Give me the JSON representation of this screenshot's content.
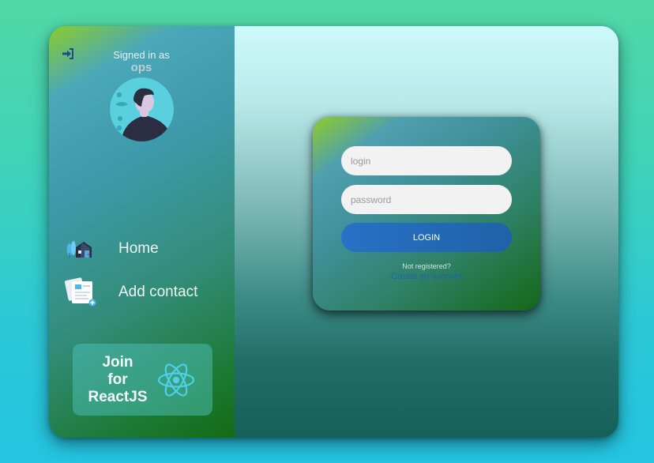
{
  "sidebar": {
    "logout_icon": "sign-out-icon",
    "signed_in_label": "Signed in as",
    "username": "ops",
    "avatar_icon": "user-avatar-illustration",
    "nav": [
      {
        "label": "Home",
        "icon": "house-icon"
      },
      {
        "label": "Add contact",
        "icon": "contact-cards-icon"
      }
    ],
    "promo": {
      "line1": "Join",
      "line2": "for",
      "line3": "ReactJS",
      "icon": "react-logo-icon"
    }
  },
  "login_form": {
    "login_placeholder": "login",
    "password_placeholder": "password",
    "login_button": "LOGIN",
    "not_registered": "Not registered?",
    "create_account": "Create an account"
  },
  "colors": {
    "accent": "#2772c6",
    "link": "#1b66b2",
    "react": "#4fd0e8"
  }
}
